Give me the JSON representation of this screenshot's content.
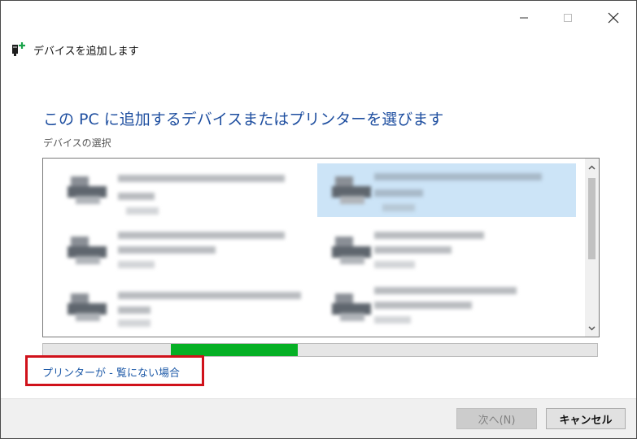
{
  "window": {
    "caption_buttons": {
      "minimize_icon": "minimize-icon",
      "maximize_icon": "maximize-icon",
      "close_icon": "close-icon"
    },
    "header_title": "デバイスを追加します",
    "header_icon": "add-device-icon"
  },
  "main": {
    "title": "この PC に追加するデバイスまたはプリンターを選びます",
    "subtitle": "デバイスの選択",
    "progress": 0.23
  },
  "devices": [
    {
      "selected": false
    },
    {
      "selected": true
    },
    {
      "selected": false
    },
    {
      "selected": false
    },
    {
      "selected": false
    },
    {
      "selected": false
    }
  ],
  "links": {
    "printer_not_listed": "プリンターが - 覧にない場合"
  },
  "footer": {
    "next_label": "次へ(N)",
    "cancel_label": "キャンセル"
  },
  "colors": {
    "title_blue": "#1f4fa0",
    "link_blue": "#1e5aa8",
    "progress_green": "#06b025",
    "highlight_red": "#d0121b",
    "selection_blue": "#cce4f7"
  }
}
